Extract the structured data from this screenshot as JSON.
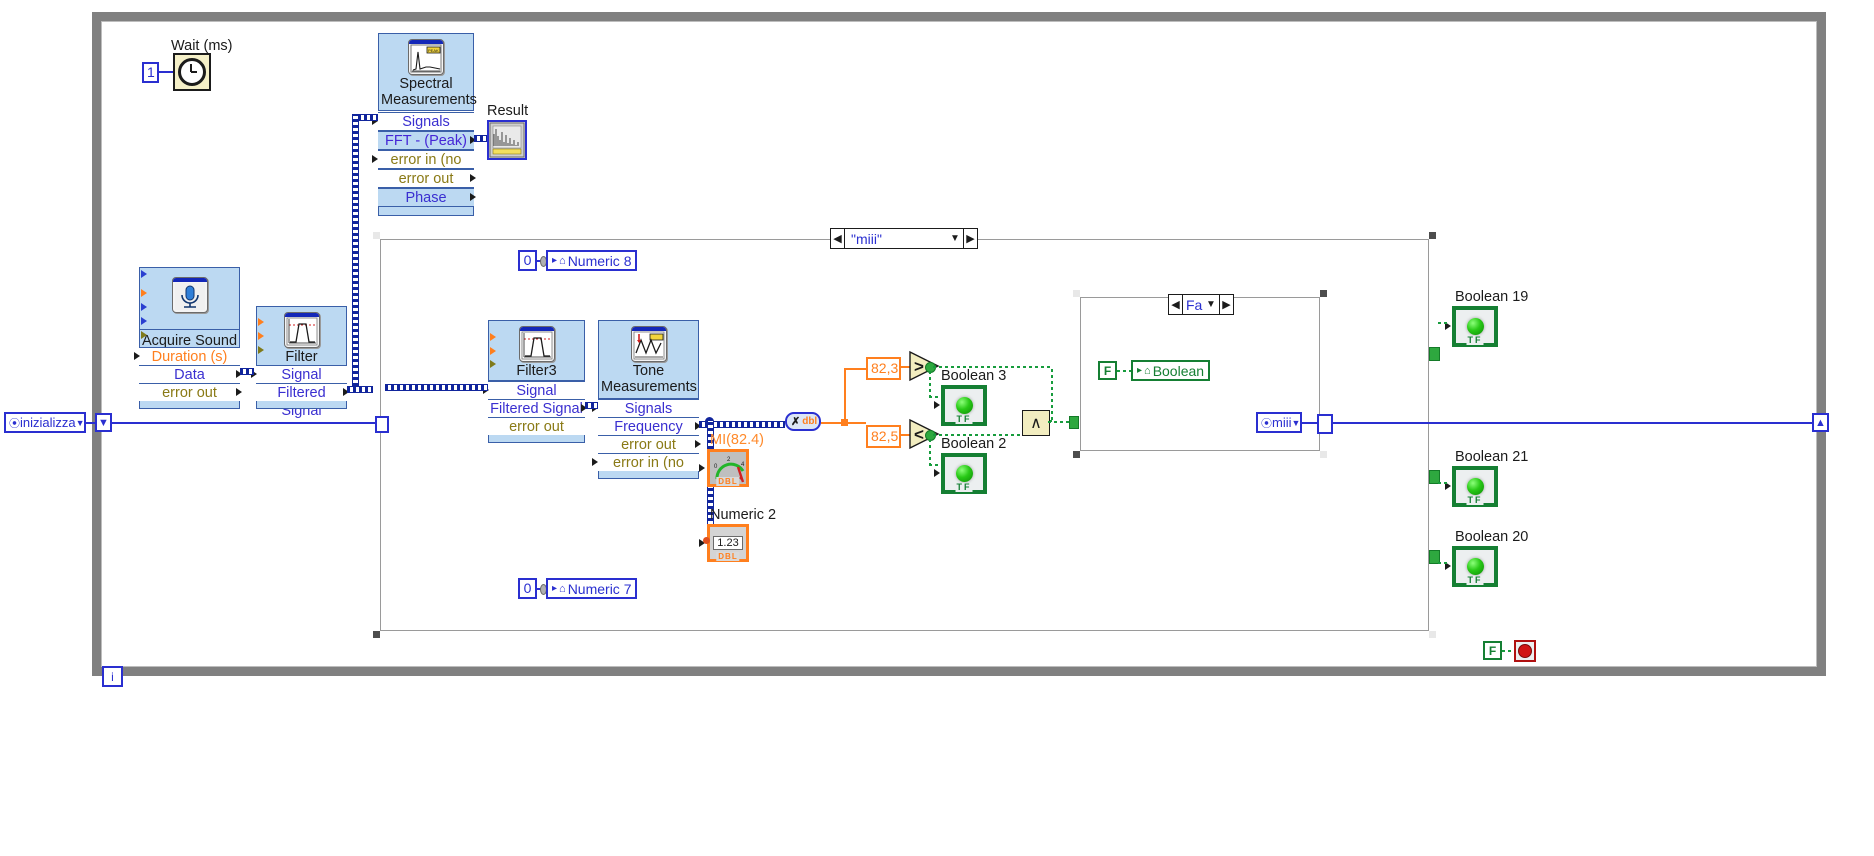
{
  "app": {
    "type": "labview-block-diagram",
    "title": "Block Diagram"
  },
  "colors": {
    "vi_body": "#bcd9f2",
    "vi_border": "#3a5fa8",
    "wire_blue": "#2a2fd0",
    "wire_orange": "#ff7f1e",
    "wire_green": "#179c3d",
    "dynamic_data_wire": "#11259c",
    "loop_border": "#808080",
    "boolean_green": "#157f33",
    "numeric_orange": "#ff7f1e",
    "constant_blue": "#2a2fd0"
  },
  "wait_node": {
    "label": "Wait (ms)",
    "constant": "1",
    "icon": "watch-icon"
  },
  "spectral_vi": {
    "title_line1": "Spectral",
    "title_line2": "Measurements",
    "icon": "peak-spectrum-icon",
    "terminals": [
      {
        "label": "Signals",
        "style": "blue"
      },
      {
        "label": "FFT - (Peak)",
        "style": "blue"
      },
      {
        "label": "error in (no error)",
        "style": "olive"
      },
      {
        "label": "error out",
        "style": "olive"
      },
      {
        "label": "Phase",
        "style": "blue"
      }
    ]
  },
  "result_indicator": {
    "label": "Result",
    "icon": "waveform-graph-icon"
  },
  "acquire_sound_vi": {
    "title": "Acquire Sound",
    "icon": "microphone-icon",
    "terminals": [
      {
        "label": "Duration (s)",
        "style": "orange"
      },
      {
        "label": "Data",
        "style": "blue"
      },
      {
        "label": "error out",
        "style": "olive"
      }
    ]
  },
  "filter_vi": {
    "title": "Filter",
    "icon": "filter-response-icon",
    "terminals": [
      {
        "label": "Signal",
        "style": "blue"
      },
      {
        "label": "Filtered Signal",
        "style": "blue"
      }
    ]
  },
  "filter3_vi": {
    "title": "Filter3",
    "icon": "filter-response-icon",
    "terminals": [
      {
        "label": "Signal",
        "style": "blue"
      },
      {
        "label": "Filtered Signal",
        "style": "blue"
      },
      {
        "label": "error out",
        "style": "olive"
      }
    ]
  },
  "tone_vi": {
    "title_line1": "Tone",
    "title_line2": "Measurements",
    "icon": "tone-waveform-icon",
    "terminals": [
      {
        "label": "Signals",
        "style": "blue"
      },
      {
        "label": "Frequency",
        "style": "blue"
      },
      {
        "label": "error out",
        "style": "olive"
      },
      {
        "label": "error in (no error)",
        "style": "olive"
      }
    ]
  },
  "mi_gauge": {
    "label": "MI(82.4)",
    "type": "DBL",
    "datatype_tag": "DBL"
  },
  "numeric2_indicator": {
    "label": "Numeric 2",
    "value": "1.23",
    "datatype_tag": "DBL"
  },
  "to_dbl_node": {
    "label": "dbl",
    "glyph": "✗"
  },
  "comparisons": [
    {
      "constant": "82,3",
      "operator": ">",
      "output_label": "Boolean 3"
    },
    {
      "constant": "82,5",
      "operator": "<",
      "output_label": "Boolean 2"
    }
  ],
  "and_node": {
    "symbol": "∧",
    "name": "and-function"
  },
  "numeric8_terminal": {
    "constant": "0",
    "label": "Numeric 8"
  },
  "numeric7_terminal": {
    "constant": "0",
    "label": "Numeric 7"
  },
  "outer_case": {
    "selector_value": "\"miii\"",
    "left_arrow": "◀",
    "right_arrow": "▶",
    "dropdown": "▼"
  },
  "inner_case": {
    "selector_value": "False",
    "left_arrow": "◀",
    "right_arrow": "▶",
    "dropdown": "▼",
    "boolean_constant": "F",
    "indicator_label": "Boolean",
    "indicator_glyph": "⌂"
  },
  "enum_terminal": {
    "label": "miii",
    "glyph": "⦿"
  },
  "init_control": {
    "label": "inizializza",
    "glyph": "⦿",
    "dropdown": "▼"
  },
  "boolean_indicators": [
    {
      "label": "Boolean 19",
      "state": "on",
      "tag": "TF"
    },
    {
      "label": "Boolean 21",
      "state": "on",
      "tag": "TF"
    },
    {
      "label": "Boolean 20",
      "state": "on",
      "tag": "TF"
    }
  ],
  "stop_node": {
    "constant": "F",
    "name": "stop-button"
  },
  "loop_iteration": {
    "label": "i"
  }
}
